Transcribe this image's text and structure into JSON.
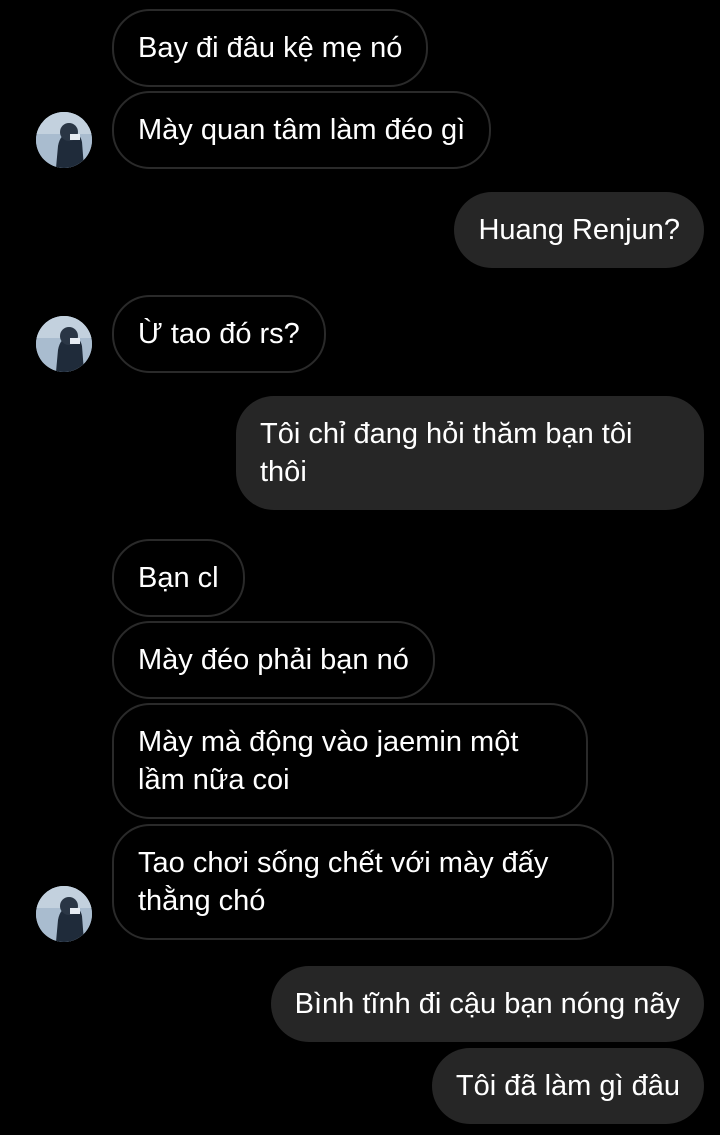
{
  "colors": {
    "background": "#000000",
    "incoming_border": "#2a2a2a",
    "outgoing_fill": "#262626",
    "text": "#ffffff"
  },
  "avatar_icon": "user-avatar-photo",
  "messages": [
    {
      "side": "in",
      "text": "Bay đi đâu kệ mẹ nó"
    },
    {
      "side": "in",
      "text": "Mày quan tâm làm đéo gì"
    },
    {
      "side": "out",
      "text": "Huang Renjun?"
    },
    {
      "side": "in",
      "text": "Ừ tao đó rs?"
    },
    {
      "side": "out",
      "text": "Tôi chỉ đang hỏi thăm bạn tôi thôi"
    },
    {
      "side": "in",
      "text": "Bạn cl"
    },
    {
      "side": "in",
      "text": "Mày đéo phải bạn nó"
    },
    {
      "side": "in",
      "text": "Mày mà động vào jaemin một lầm nữa coi"
    },
    {
      "side": "in",
      "text": "Tao chơi sống chết với mày đấy thằng chó"
    },
    {
      "side": "out",
      "text": "Bình tĩnh đi cậu bạn nóng nãy"
    },
    {
      "side": "out",
      "text": "Tôi đã làm gì đâu"
    }
  ]
}
